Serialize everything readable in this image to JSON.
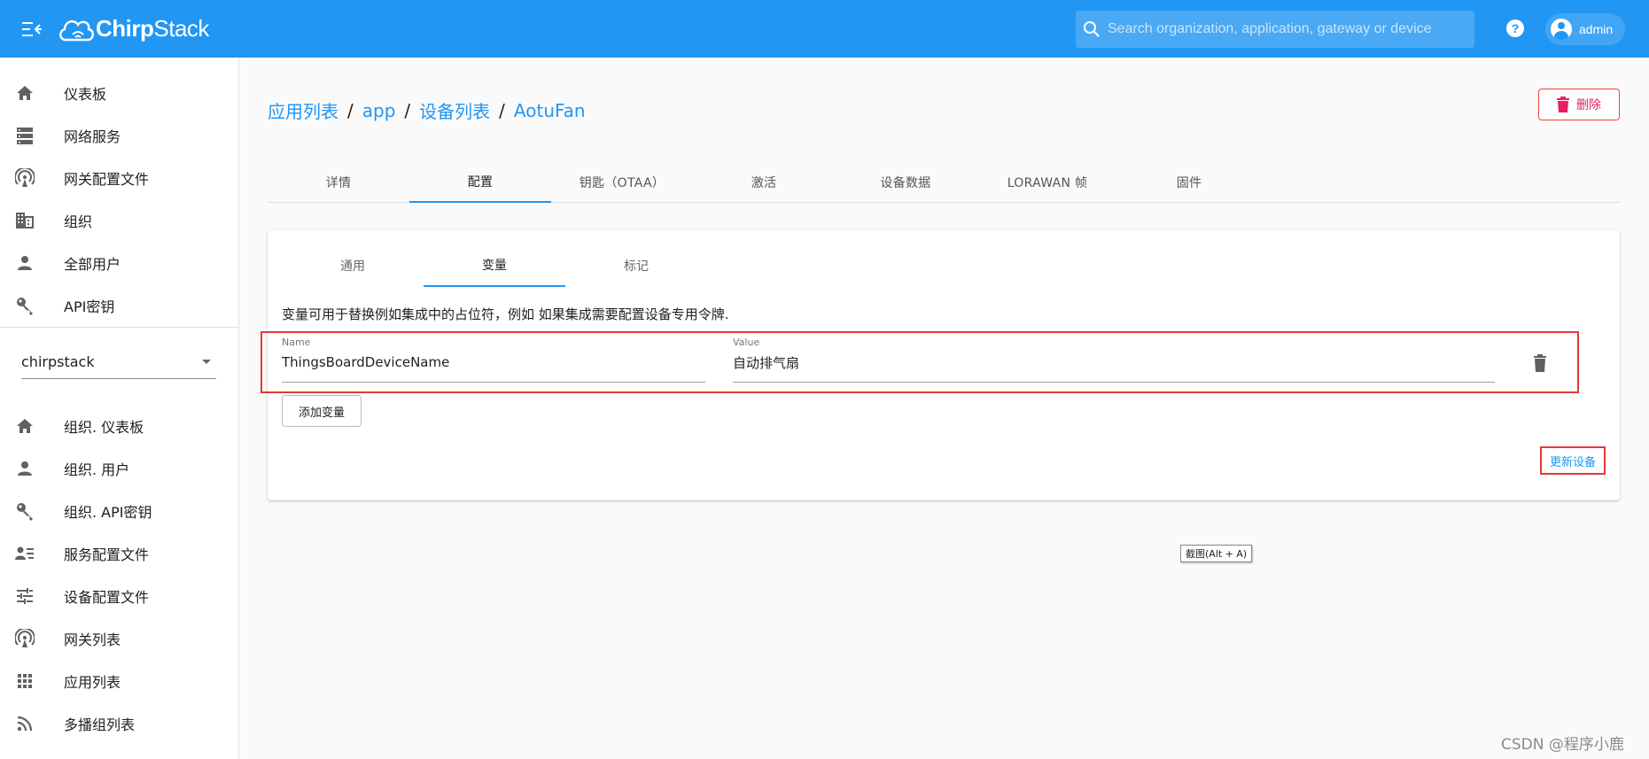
{
  "colors": {
    "primary": "#2196f3",
    "danger": "#e91e63",
    "highlight_box": "#e53935"
  },
  "appbar": {
    "logo": {
      "bold": "Chirp",
      "regular": "Stack"
    },
    "search_placeholder": "Search organization, application, gateway or device",
    "user": "admin",
    "icons": {
      "menu": "menu-open-icon",
      "search": "search-icon",
      "help": "help-circle-icon",
      "account": "account-circle-icon"
    }
  },
  "sidebar": {
    "global_items": [
      {
        "label": "仪表板",
        "icon": "home-icon"
      },
      {
        "label": "网络服务",
        "icon": "server-icon"
      },
      {
        "label": "网关配置文件",
        "icon": "radio-tower-icon"
      },
      {
        "label": "组织",
        "icon": "domain-icon"
      },
      {
        "label": "全部用户",
        "icon": "account-icon"
      },
      {
        "label": "API密钥",
        "icon": "key-icon"
      }
    ],
    "org_select": {
      "value": "chirpstack"
    },
    "org_items": [
      {
        "label": "组织. 仪表板",
        "icon": "home-icon"
      },
      {
        "label": "组织. 用户",
        "icon": "account-icon"
      },
      {
        "label": "组织. API密钥",
        "icon": "key-icon"
      },
      {
        "label": "服务配置文件",
        "icon": "account-details-icon"
      },
      {
        "label": "设备配置文件",
        "icon": "tune-icon"
      },
      {
        "label": "网关列表",
        "icon": "radio-tower-icon"
      },
      {
        "label": "应用列表",
        "icon": "apps-icon"
      },
      {
        "label": "多播组列表",
        "icon": "rss-icon"
      }
    ]
  },
  "breadcrumb": {
    "items": [
      "应用列表",
      "app",
      "设备列表",
      "AotuFan"
    ],
    "separator": "/"
  },
  "delete_button": {
    "label": "删除",
    "icon": "trash-icon"
  },
  "tabs": [
    "详情",
    "配置",
    "钥匙（OTAA）",
    "激活",
    "设备数据",
    "LORAWAN 帧",
    "固件"
  ],
  "active_tab": "配置",
  "card": {
    "subtabs": [
      "通用",
      "变量",
      "标记"
    ],
    "active_subtab": "变量",
    "description": "变量可用于替换例如集成中的占位符，例如 如果集成需要配置设备专用令牌.",
    "variable": {
      "name_label": "Name",
      "name_value": "ThingsBoardDeviceName",
      "value_label": "Value",
      "value_value": "自动排气扇",
      "delete_icon": "trash-icon"
    },
    "add_button": "添加变量",
    "update_button": "更新设备"
  },
  "tooltip": "截图(Alt + A)",
  "watermark": "CSDN @程序小鹿"
}
